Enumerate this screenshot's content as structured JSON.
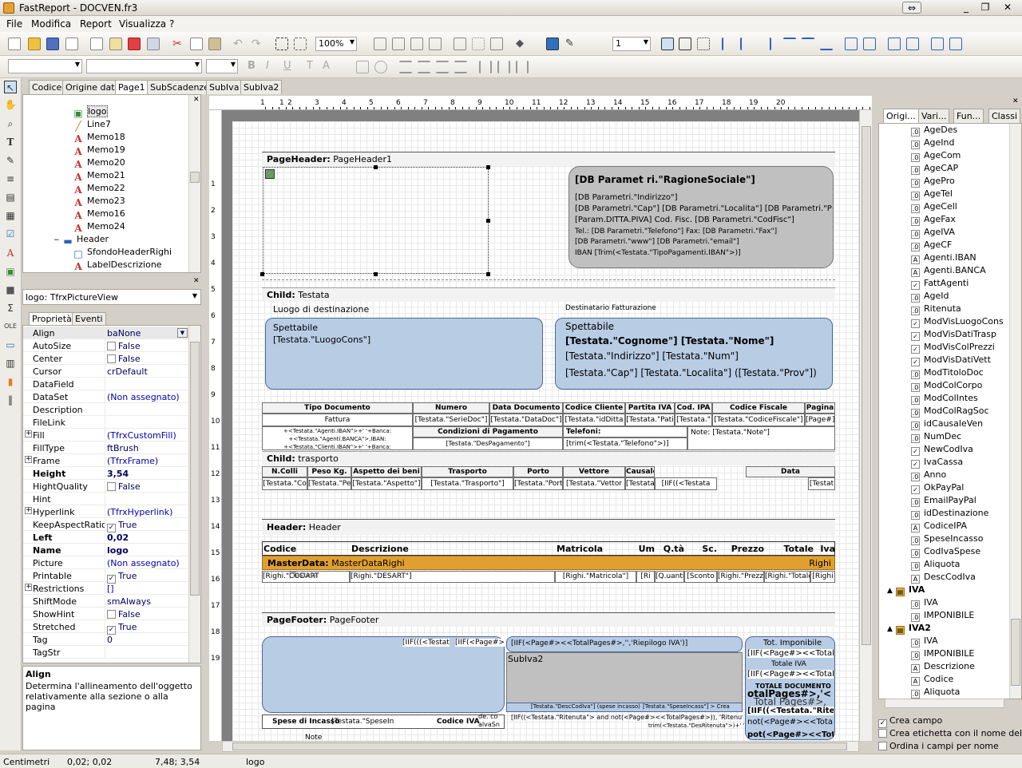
{
  "window": {
    "title": "FastReport - DOCVEN.fr3"
  },
  "menu": [
    "File",
    "Modifica",
    "Report",
    "Visualizza",
    "?"
  ],
  "toolbar": {
    "zoom": "100%",
    "line_width": "1"
  },
  "design_tabs": [
    "Codice",
    "Origine dati",
    "Page1",
    "SubScadenze",
    "SubIva",
    "SubIva2"
  ],
  "tree": [
    {
      "label": "logo",
      "icon": "picture-icon",
      "level": 3,
      "selected": true
    },
    {
      "label": "Line7",
      "icon": "line-icon",
      "level": 3
    },
    {
      "label": "Memo18",
      "icon": "text-memo-icon",
      "level": 3
    },
    {
      "label": "Memo19",
      "icon": "text-memo-icon",
      "level": 3
    },
    {
      "label": "Memo20",
      "icon": "text-memo-icon",
      "level": 3
    },
    {
      "label": "Memo21",
      "icon": "text-memo-icon",
      "level": 3
    },
    {
      "label": "Memo22",
      "icon": "text-memo-icon",
      "level": 3
    },
    {
      "label": "Memo23",
      "icon": "text-memo-icon",
      "level": 3
    },
    {
      "label": "Memo16",
      "icon": "text-memo-icon",
      "level": 3
    },
    {
      "label": "Memo24",
      "icon": "text-memo-icon",
      "level": 3
    },
    {
      "label": "Header",
      "icon": "band-icon",
      "level": 2,
      "expander": "−"
    },
    {
      "label": "SfondoHeaderRighi",
      "icon": "shape-icon",
      "level": 3
    },
    {
      "label": "LabelDescrizione",
      "icon": "text-memo-icon",
      "level": 3
    }
  ],
  "inspector": {
    "object": "logo: TfrxPictureView",
    "tabs": [
      "Proprietà",
      "Eventi"
    ],
    "props": [
      {
        "name": "Align",
        "value": "baNone",
        "dropdown": true
      },
      {
        "name": "AutoSize",
        "value": "False",
        "check": false
      },
      {
        "name": "Center",
        "value": "False",
        "check": false
      },
      {
        "name": "Cursor",
        "value": "crDefault"
      },
      {
        "name": "DataField",
        "value": ""
      },
      {
        "name": "DataSet",
        "value": "(Non assegnato)"
      },
      {
        "name": "Description",
        "value": ""
      },
      {
        "name": "FileLink",
        "value": ""
      },
      {
        "name": "Fill",
        "value": "(TfrxCustomFill)",
        "expand": true
      },
      {
        "name": "FillType",
        "value": "ftBrush"
      },
      {
        "name": "Frame",
        "value": "(TfrxFrame)",
        "expand": true
      },
      {
        "name": "Height",
        "value": "3,54",
        "bold": true
      },
      {
        "name": "HightQuality",
        "value": "False",
        "check": false
      },
      {
        "name": "Hint",
        "value": ""
      },
      {
        "name": "Hyperlink",
        "value": "(TfrxHyperlink)",
        "expand": true
      },
      {
        "name": "KeepAspectRatio",
        "value": "True",
        "check": true
      },
      {
        "name": "Left",
        "value": "0,02",
        "bold": true
      },
      {
        "name": "Name",
        "value": "logo",
        "bold": true
      },
      {
        "name": "Picture",
        "value": "(Non assegnato)"
      },
      {
        "name": "Printable",
        "value": "True",
        "check": true
      },
      {
        "name": "Restrictions",
        "value": "[]",
        "expand": true
      },
      {
        "name": "ShiftMode",
        "value": "smAlways"
      },
      {
        "name": "ShowHint",
        "value": "False",
        "check": false
      },
      {
        "name": "Stretched",
        "value": "True",
        "check": true
      },
      {
        "name": "Tag",
        "value": "0"
      },
      {
        "name": "TagStr",
        "value": ""
      }
    ],
    "hint_title": "Align",
    "hint_text": "Determina l'allineamento dell'oggetto relativamente alla sezione o alla pagina"
  },
  "ruler_h": [
    "1",
    "1",
    "2",
    "3",
    "4",
    "5",
    "6",
    "7",
    "8",
    "9",
    "10",
    "11",
    "12",
    "13",
    "14",
    "15",
    "16",
    "17",
    "18",
    "19",
    "20"
  ],
  "ruler_v": [
    "1",
    "2",
    "3",
    "4",
    "5",
    "6",
    "7",
    "8",
    "9",
    "10",
    "11",
    "12",
    "13",
    "14",
    "15",
    "16",
    "17",
    "18",
    "19"
  ],
  "report": {
    "page_header": {
      "kind": "PageHeader:",
      "name": "PageHeader1"
    },
    "company": {
      "ragione": "[DB Paramet ri.\"RagioneSociale\"]",
      "lines": [
        "[DB Parametri.\"Indirizzo\"]",
        "[DB Parametri.\"Cap\"] [DB Parametri.\"Localita\"] [DB Parametri.\"P",
        "[Param.DITTA.PIVA]  Cod. Fisc. [DB Parametri.\"CodFisc\"]",
        "Tel.: [DB Parametri.\"Telefono\"] Fax: [DB Parametri.\"Fax\"]",
        "[DB Parametri.\"www\"] [DB Parametri.\"email\"]",
        "IBAN    [Trim(<Testata.\"TipoPagamenti.IBAN\">)]"
      ]
    },
    "child_testata": {
      "kind": "Child:",
      "name": "Testata"
    },
    "luogo_label": "Luogo di destinazione",
    "dest_label": "Destinatario Fatturazione",
    "sped_left": {
      "title": "Spettabile",
      "value": "[Testata.\"LuogoCons\"]"
    },
    "sped_right": {
      "title": "Spettabile",
      "name": "[Testata.\"Cognome\"] [Testata.\"Nome\"]",
      "addr": "[Testata.\"Indirizzo\"] [Testata.\"Num\"]",
      "city": "[Testata.\"Cap\"] [Testata.\"Localita\"] ([Testata.\"Prov\"])"
    },
    "doc_headers": [
      "Tipo Documento",
      "Numero",
      "Data Documento",
      "Codice Cliente",
      "Partita IVA",
      "Cod. IPA",
      "Codice Fiscale",
      "Pagina"
    ],
    "doc_values": [
      "Fattura",
      "[Testata.\"SerieDoc\"]",
      "[Testata.\"DataDoc\"]",
      "[Testata.\"idDitta",
      "[Testata.\"Pati",
      "[Testata.\"",
      "[Testata.\"CodiceFiscale\"]",
      "[Page#]"
    ],
    "bank_lines": [
      "+<Testata.\"Agenti.IBAN\">+' '+Banca:",
      "+<Testata.\"Agenti.BANCA\">,IBAN:",
      "+<Testata.\"Clienti.IBAN\">+' '+Banca:"
    ],
    "cond_label": "Condizioni di Pagamento",
    "cond_value": "[Testata.\"DesPagamento\"]",
    "tel_label": "Telefoni:",
    "tel_value": "[trim(<Testata.\"Telefono\">)]",
    "note_value": "Note: [Testata.\"Note\"]",
    "child_trasporto": {
      "kind": "Child:",
      "name": "trasporto"
    },
    "tr_headers": [
      "N.Colli",
      "Peso Kg.",
      "Aspetto dei beni",
      "Trasporto",
      "Porto",
      "Vettore",
      "Causale",
      "Data"
    ],
    "tr_values": [
      "[Testata.\"Co",
      "[Testata.\"Pe",
      "[Testata.\"Aspetto\"]",
      "[Testata.\"Trasporto\"]",
      "[Testata.\"Porto\"]",
      "[Testata.\"Vettor",
      "[Testata.\"Causale\"]",
      "[IIF((<Testata",
      "[Testat"
    ],
    "header_band": {
      "kind": "Header:",
      "name": "Header"
    },
    "col_headers": [
      "Codice",
      "Descrizione",
      "Matricola",
      "Um",
      "Q.tà",
      "Sc.",
      "Prezzo",
      "Totale",
      "Iva"
    ],
    "master": {
      "kind": "MasterData:",
      "name": "MasterDataRighi",
      "source": "Righi"
    },
    "row_values": [
      "[Righi.\"CODART",
      "[Righi.\"DESART\"]",
      "[Righi.\"Matricola\"]",
      "[Ri",
      "[Q.uantita\"]",
      "[Sconto",
      "[Righi.\"Prezzo\"]",
      "[Righi.\"Totale",
      "[Righi"
    ],
    "row_overlap": "[Testata",
    "page_footer": {
      "kind": "PageFooter:",
      "name": "PageFooter"
    },
    "footer": {
      "iif1": "[IIF(((<Testat",
      "iif2": "[IIF(<Page#>",
      "riepilogo": "[IIF(<Page#><<TotalPages#>,'','Riepilogo IVA')]",
      "subiva": "SubIva2",
      "tot_imp": "Tot. Imponibile",
      "tot_imp_val": "[IIF(<Page#><<TotalP",
      "tot_iva": "Totale IVA",
      "tot_iva_val": "[IIF(<Page#><<TotalP",
      "tot_doc": "TOTALE DOCUMENTO",
      "tot_doc_val1": "otalPages#>,'<",
      "tot_doc_val2": "Total Pages#>,",
      "ritenuta": "[IIF((<Testata.\"Ritenuta",
      "not_page": "not(<Page#><<TotalP",
      "pot": "pot(<Page#><<TotalPag",
      "spese": "Spese di Incasso",
      "spese_val": "[Testata.\"SpeseIn",
      "codiva": "Codice IVA",
      "desccodiva": "[Testata.\"DescCodIva\"] (spese incasso)",
      "ritenuta_long": "[IIF((<Testata.\"Ritenuta\"> and not(<Page#><<TotalPages#>)), 'Ritenuta d'acconto ' +",
      "trim_ritenuta": "trim(<Testata.\"DesRitenuta\">)+' '",
      "desc_small1": "de. co",
      "desc_small2": "alvaSn",
      "spese_small": "[Testata.\"SpeseIncass\"] > Crea",
      "note": "Note"
    }
  },
  "right_tabs": [
    "Origi...",
    "Vari...",
    "Fun...",
    "Classi"
  ],
  "fields": [
    {
      "name": "AgeDes",
      "icon": "num"
    },
    {
      "name": "AgeInd",
      "icon": "num"
    },
    {
      "name": "AgeCom",
      "icon": "num"
    },
    {
      "name": "AgeCAP",
      "icon": "num"
    },
    {
      "name": "AgePro",
      "icon": "num"
    },
    {
      "name": "AgeTel",
      "icon": "num"
    },
    {
      "name": "AgeCell",
      "icon": "num"
    },
    {
      "name": "AgeFax",
      "icon": "num"
    },
    {
      "name": "AgeIVA",
      "icon": "num"
    },
    {
      "name": "AgeCF",
      "icon": "num"
    },
    {
      "name": "Agenti.IBAN",
      "icon": "text"
    },
    {
      "name": "Agenti.BANCA",
      "icon": "text"
    },
    {
      "name": "FattAgenti",
      "icon": "check"
    },
    {
      "name": "AgeId",
      "icon": "num"
    },
    {
      "name": "Ritenuta",
      "icon": "num"
    },
    {
      "name": "ModVisLuogoCons",
      "icon": "check"
    },
    {
      "name": "ModVisDatiTrasp",
      "icon": "check"
    },
    {
      "name": "ModVisColPrezzi",
      "icon": "check"
    },
    {
      "name": "ModVisDatiVett",
      "icon": "check"
    },
    {
      "name": "ModTitoloDoc",
      "icon": "num"
    },
    {
      "name": "ModColCorpo",
      "icon": "num"
    },
    {
      "name": "ModColIntes",
      "icon": "num"
    },
    {
      "name": "ModColRagSoc",
      "icon": "num"
    },
    {
      "name": "idCausaleVen",
      "icon": "num"
    },
    {
      "name": "NumDec",
      "icon": "num"
    },
    {
      "name": "NewCodIva",
      "icon": "check"
    },
    {
      "name": "IvaCassa",
      "icon": "check"
    },
    {
      "name": "Anno",
      "icon": "num"
    },
    {
      "name": "OkPayPal",
      "icon": "check"
    },
    {
      "name": "EmailPayPal",
      "icon": "num"
    },
    {
      "name": "idDestinazione",
      "icon": "num"
    },
    {
      "name": "CodiceIPA",
      "icon": "text"
    },
    {
      "name": "SpeseIncasso",
      "icon": "num"
    },
    {
      "name": "CodIvaSpese",
      "icon": "num"
    },
    {
      "name": "Aliquota",
      "icon": "num"
    },
    {
      "name": "DescCodIva",
      "icon": "text"
    },
    {
      "name": "IVA",
      "icon": "db",
      "group": true
    },
    {
      "name": "IVA",
      "icon": "num"
    },
    {
      "name": "IMPONIBILE",
      "icon": "num"
    },
    {
      "name": "IVA2",
      "icon": "db",
      "group": true
    },
    {
      "name": "IVA",
      "icon": "num"
    },
    {
      "name": "IMPONIBILE",
      "icon": "num"
    },
    {
      "name": "Descrizione",
      "icon": "text"
    },
    {
      "name": "Codice",
      "icon": "text"
    },
    {
      "name": "Aliquota",
      "icon": "num"
    }
  ],
  "right_options": [
    {
      "label": "Crea campo",
      "checked": true
    },
    {
      "label": "Crea etichetta con il nome del cam",
      "checked": false
    },
    {
      "label": "Ordina i campi per nome",
      "checked": false
    }
  ],
  "status": {
    "units": "Centimetri",
    "pos": "0,02; 0,02",
    "size": "7,48; 3,54",
    "object": "logo"
  },
  "colors": {
    "band_header": "#f2f2f2",
    "master_band": "#e0a030",
    "rounded_fill": "#b8cce4",
    "grey_fill": "#c0c0c0"
  }
}
